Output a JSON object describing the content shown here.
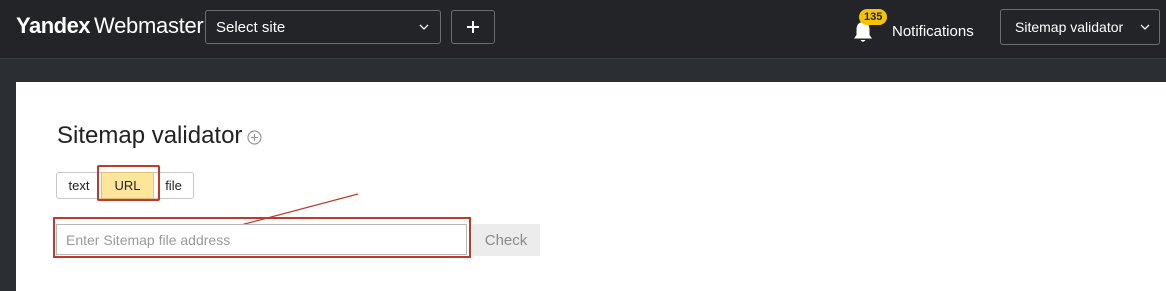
{
  "header": {
    "logo_brand": "Yandex",
    "logo_product": "Webmaster",
    "site_select_label": "Select site",
    "add_label": "+",
    "notifications_count": "135",
    "notifications_label": "Notifications",
    "tool_select_label": "Sitemap validator"
  },
  "main": {
    "title": "Sitemap validator",
    "tabs": [
      {
        "label": "text",
        "selected": false
      },
      {
        "label": "URL",
        "selected": true
      },
      {
        "label": "file",
        "selected": false
      }
    ],
    "url_input": {
      "value": "",
      "placeholder": "Enter Sitemap file address"
    },
    "check_label": "Check"
  },
  "colors": {
    "header_bg": "#222428",
    "badge": "#f5c400",
    "selected_tab": "#fde69a",
    "annotation_red": "#c0392b"
  },
  "icons": [
    "chevron-down-icon",
    "plus-icon",
    "bell-icon",
    "info-icon",
    "annotation-arrow"
  ]
}
